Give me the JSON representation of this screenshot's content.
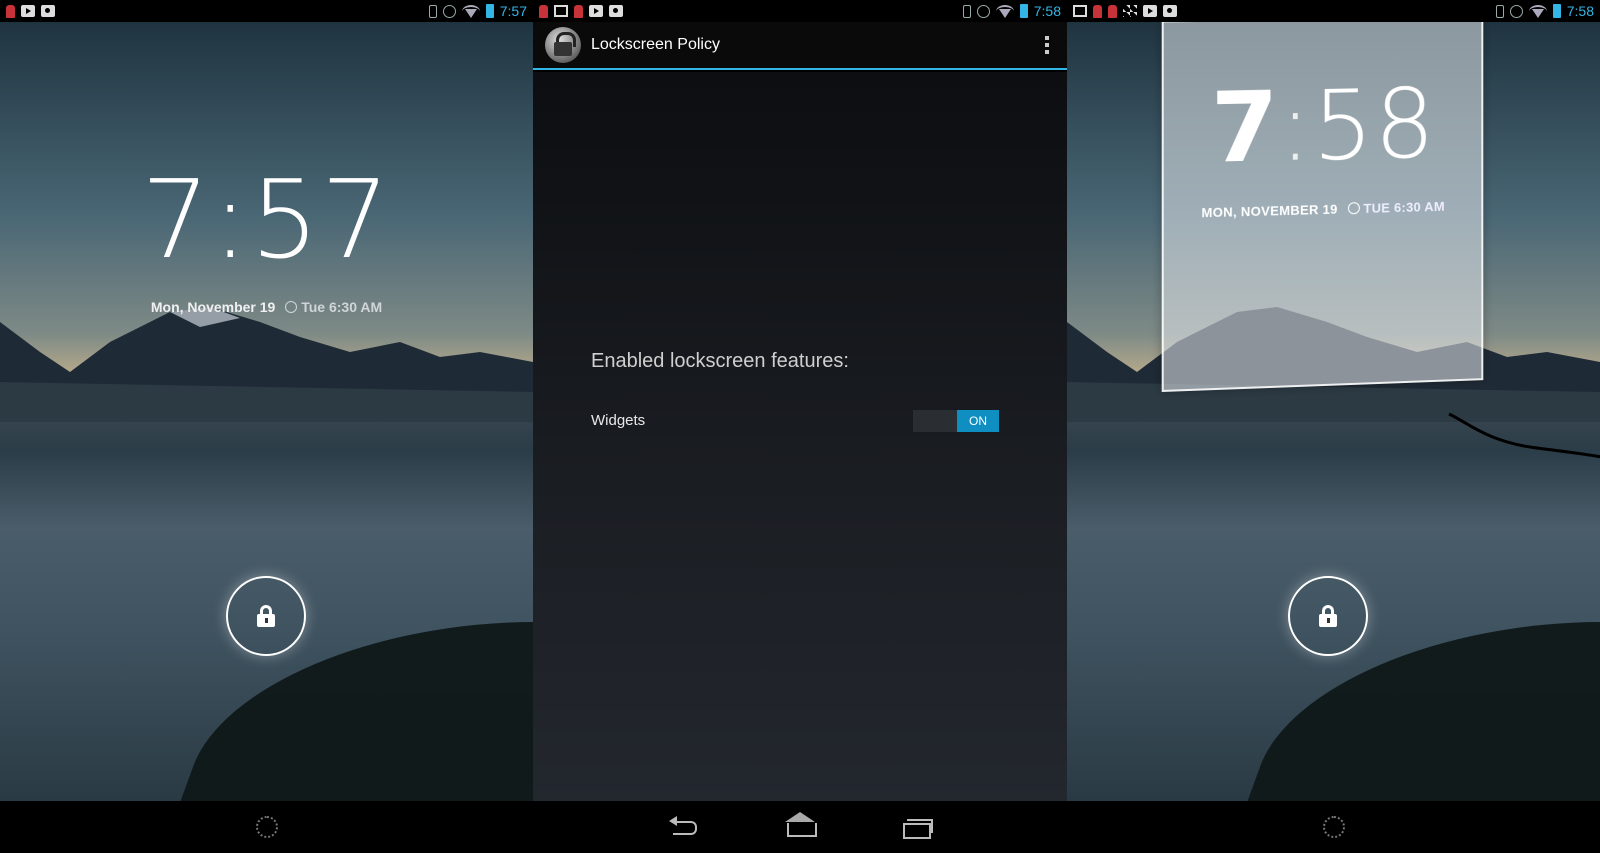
{
  "left_screen": {
    "status": {
      "time": "7:57"
    },
    "clock": "7:57",
    "date": "Mon, November 19",
    "alarm": "Tue 6:30 AM"
  },
  "middle_screen": {
    "status": {
      "time": "7:58"
    },
    "app_title": "Lockscreen Policy",
    "section_heading": "Enabled lockscreen features:",
    "widgets_label": "Widgets",
    "widgets_toggle": "ON"
  },
  "right_screen": {
    "status": {
      "time": "7:58"
    },
    "clock_hour": "7",
    "clock_colon": ":",
    "clock_minutes": "58",
    "date": "MON, NOVEMBER 19",
    "alarm": "TUE 6:30 AM"
  },
  "colors": {
    "accent": "#33b5e5",
    "toggle_on": "#0f8ec2"
  }
}
